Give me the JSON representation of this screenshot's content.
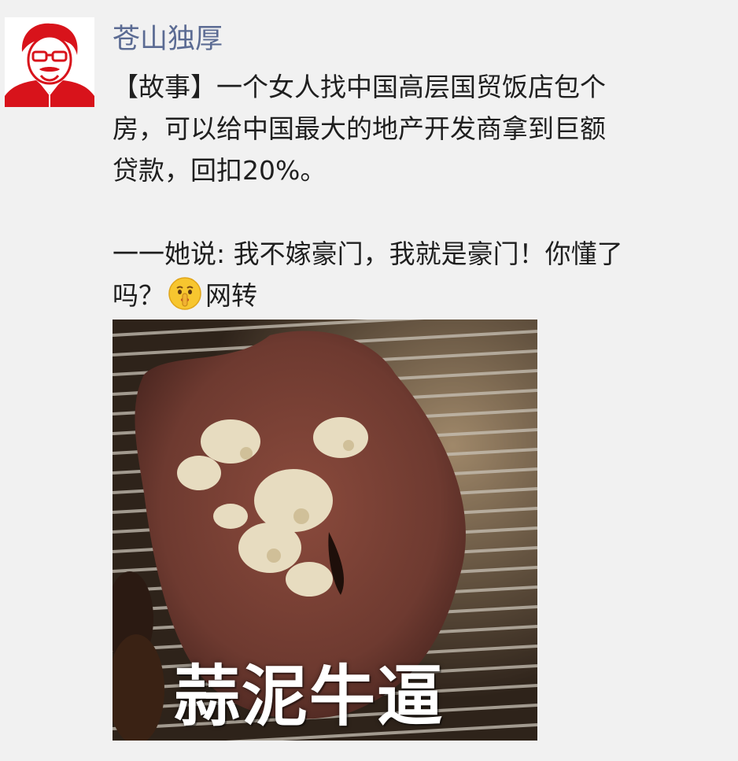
{
  "post": {
    "author": "苍山独厚",
    "lines": [
      "【故事】一个女人找中国高层国贸饭店包个",
      "房，可以给中国最大的地产开发商拿到巨额",
      "贷款，回扣20%。",
      "一一她说: 我不嫁豪门，我就是豪门！你懂了"
    ],
    "last_line_before_emoji": "吗？",
    "emoji": "shushing-face-emoji",
    "last_line_after_emoji": "网转"
  },
  "image": {
    "caption": "蒜泥牛逼"
  },
  "colors": {
    "background": "#f1f1f1",
    "author_name": "#5b6b93",
    "text": "#1f1f1f",
    "avatar_red": "#d8131b"
  }
}
